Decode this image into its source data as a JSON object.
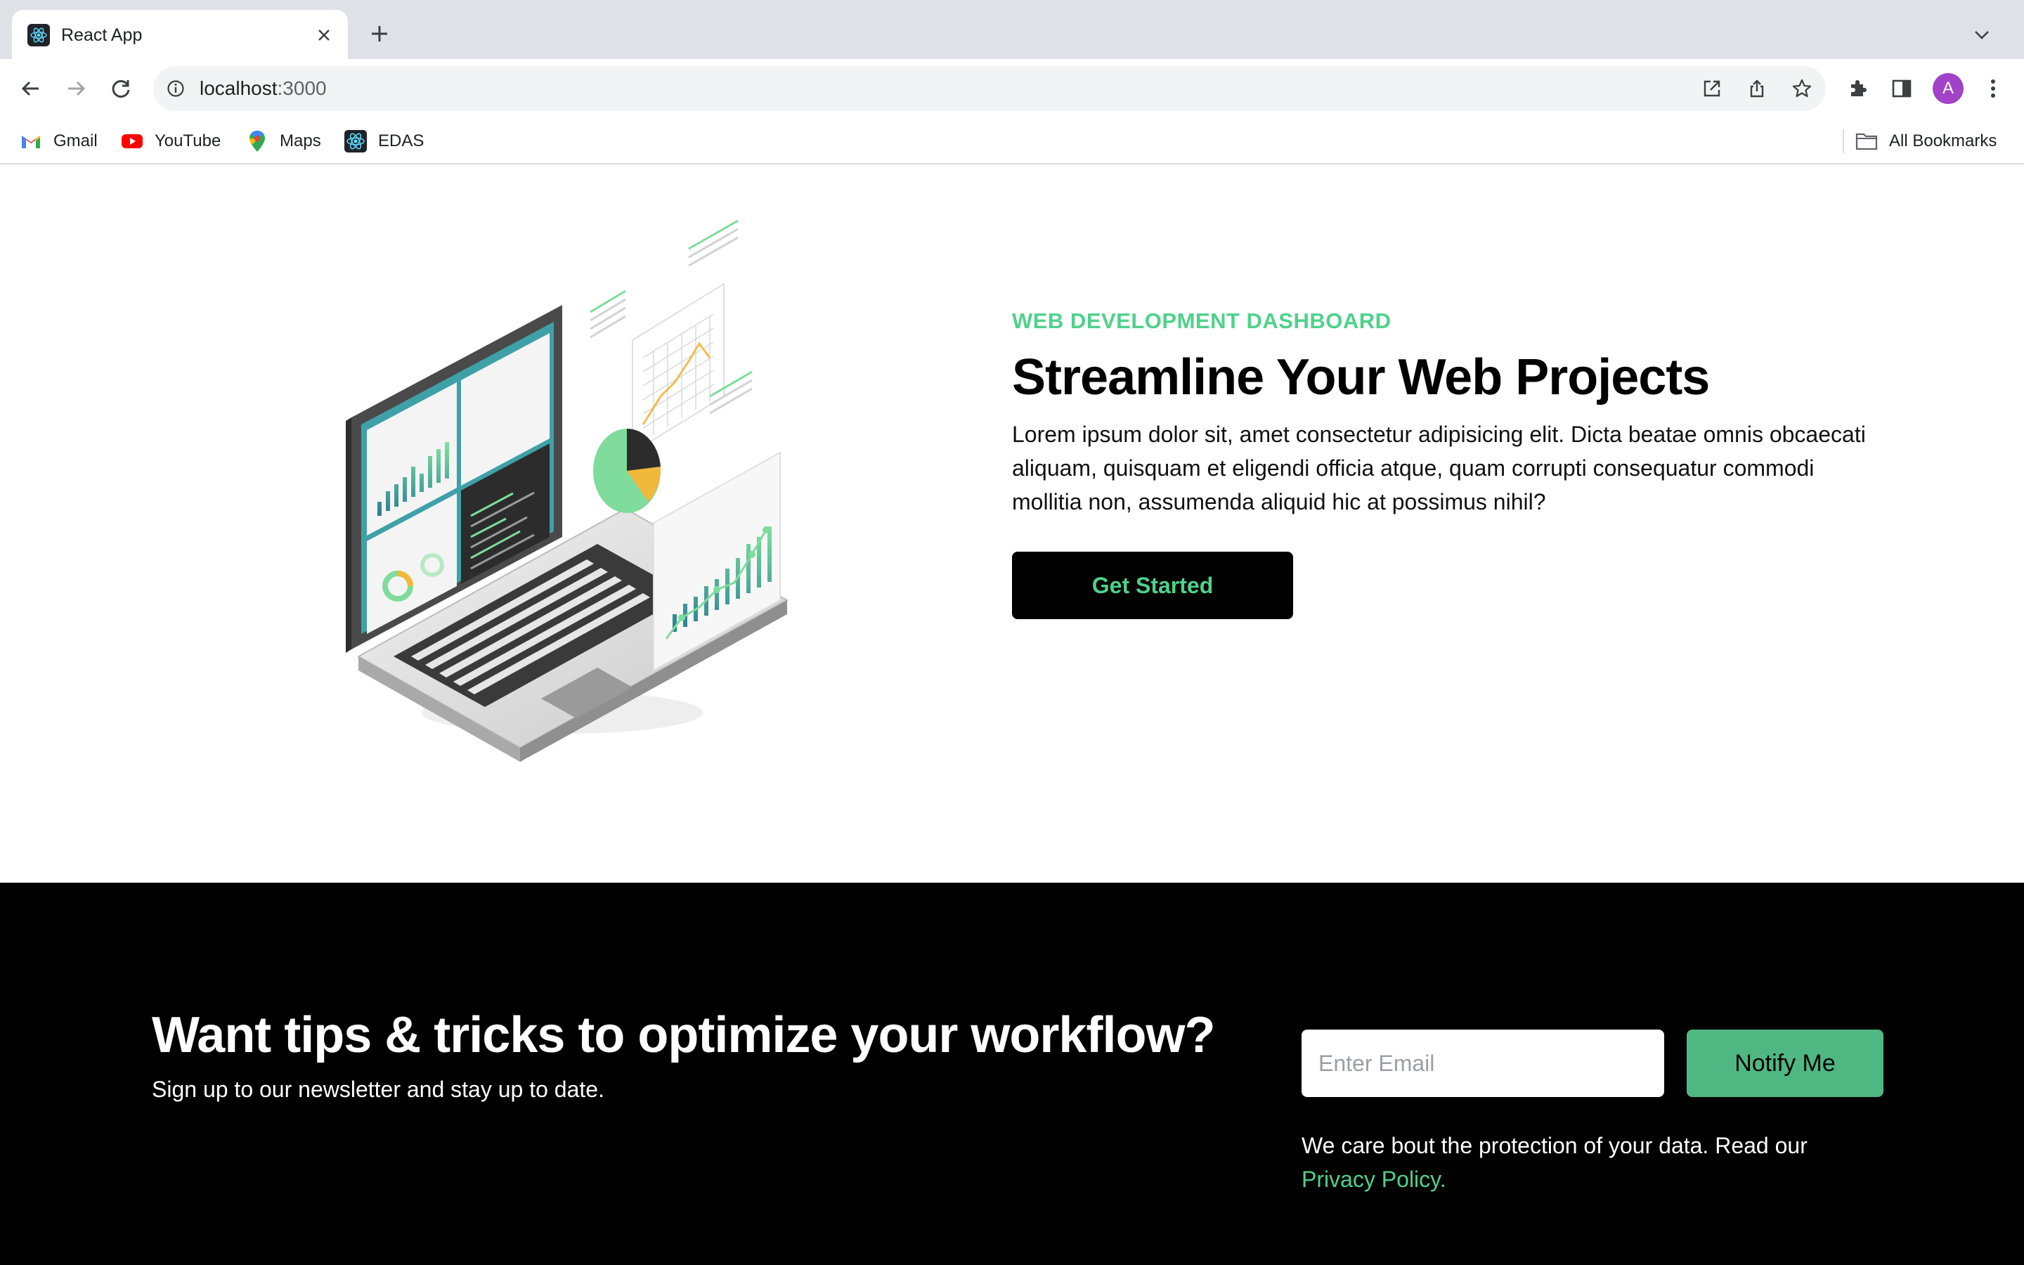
{
  "browser": {
    "tab": {
      "title": "React App",
      "favicon": "react-logo-icon"
    },
    "url": {
      "host": "localhost",
      "port": ":3000"
    },
    "bookmarks": [
      {
        "label": "Gmail",
        "icon": "gmail-icon"
      },
      {
        "label": "YouTube",
        "icon": "youtube-icon"
      },
      {
        "label": "Maps",
        "icon": "maps-icon"
      },
      {
        "label": "EDAS",
        "icon": "react-logo-icon"
      }
    ],
    "all_bookmarks_label": "All Bookmarks",
    "profile_initial": "A",
    "colors": {
      "profile": "#a142c9",
      "tabstrip": "#dee1e6"
    }
  },
  "hero": {
    "eyebrow": "WEB DEVELOPMENT DASHBOARD",
    "title": "Streamline Your Web Projects",
    "description": "Lorem ipsum dolor sit, amet consectetur adipisicing elit. Dicta beatae omnis obcaecati aliquam, quisquam et eligendi officia atque, quam corrupti consequatur commodi mollitia non, assumenda aliquid hic at possimus nihil?",
    "cta_label": "Get Started",
    "illustration": "isometric-laptop-dashboard-illustration"
  },
  "newsletter": {
    "title": "Want tips & tricks to optimize your workflow?",
    "subtitle": "Sign up to our newsletter and stay up to date.",
    "email_placeholder": "Enter Email",
    "button_label": "Notify Me",
    "privacy_text": "We care bout the protection of your data. Read our",
    "privacy_link": "Privacy Policy."
  },
  "colors": {
    "accent": "#4fd18b",
    "button_green": "#4fb882",
    "dark": "#000000"
  }
}
